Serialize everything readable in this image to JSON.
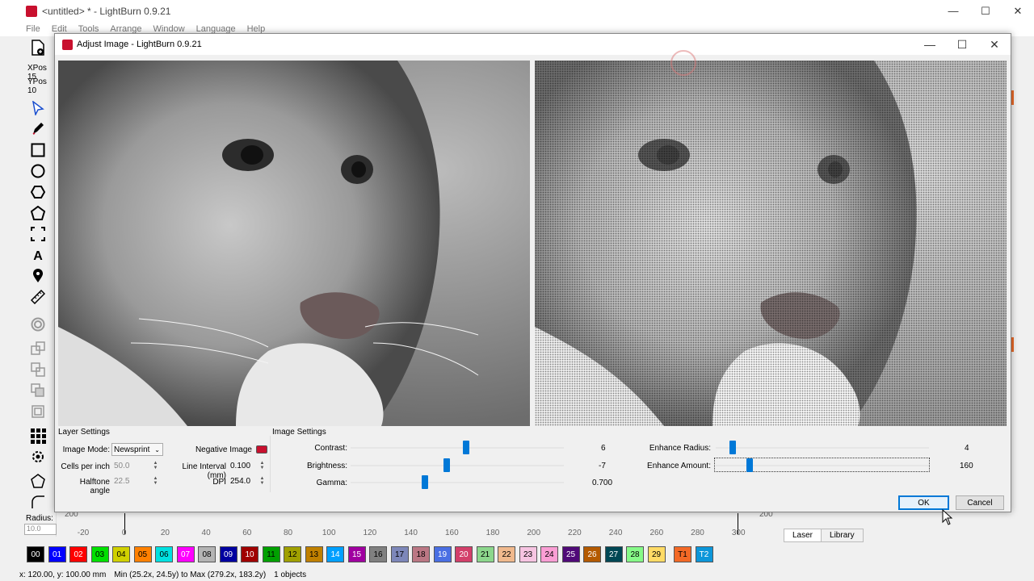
{
  "main_window": {
    "title": "<untitled> * - LightBurn 0.9.21",
    "menu": [
      "File",
      "Edit",
      "Tools",
      "Arrange",
      "Window",
      "Language",
      "Help"
    ],
    "xpos_label": "XPos 15",
    "ypos_label": "YPos 10",
    "radius_label": "Radius:",
    "radius_value": "10.0"
  },
  "dialog": {
    "title": "Adjust Image - LightBurn 0.9.21",
    "layer_settings": {
      "title": "Layer Settings",
      "image_mode_label": "Image Mode:",
      "image_mode_value": "Newsprint",
      "negative_image_label": "Negative Image",
      "cells_per_inch_label": "Cells per inch",
      "cells_per_inch_value": "50.0",
      "line_interval_label": "Line Interval (mm)",
      "line_interval_value": "0.100",
      "halftone_angle_label": "Halftone angle",
      "halftone_angle_value": "22.5",
      "dpi_label": "DPI",
      "dpi_value": "254.0"
    },
    "image_settings": {
      "title": "Image Settings",
      "contrast_label": "Contrast:",
      "contrast_value": "6",
      "brightness_label": "Brightness:",
      "brightness_value": "-7",
      "gamma_label": "Gamma:",
      "gamma_value": "0.700",
      "enhance_radius_label": "Enhance Radius:",
      "enhance_radius_value": "4",
      "enhance_amount_label": "Enhance Amount:",
      "enhance_amount_value": "160"
    },
    "ok_label": "OK",
    "cancel_label": "Cancel"
  },
  "ruler_ticks": [
    "-20",
    "0",
    "20",
    "40",
    "60",
    "80",
    "100",
    "120",
    "140",
    "160",
    "180",
    "200",
    "220",
    "240",
    "260",
    "280",
    "300"
  ],
  "ruler_side_labels": [
    "200",
    "200"
  ],
  "right_tabs": [
    "Laser",
    "Library"
  ],
  "palette": [
    {
      "label": "00",
      "color": "#000000",
      "text": "#ffffff"
    },
    {
      "label": "01",
      "color": "#0000ff",
      "text": "#ffffff"
    },
    {
      "label": "02",
      "color": "#ff0000",
      "text": "#ffffff"
    },
    {
      "label": "03",
      "color": "#00e000",
      "text": "#000000"
    },
    {
      "label": "04",
      "color": "#d0d000",
      "text": "#000000"
    },
    {
      "label": "05",
      "color": "#ff8000",
      "text": "#000000"
    },
    {
      "label": "06",
      "color": "#00e0e0",
      "text": "#000000"
    },
    {
      "label": "07",
      "color": "#ff00ff",
      "text": "#ffffff"
    },
    {
      "label": "08",
      "color": "#b4b4b4",
      "text": "#000000"
    },
    {
      "label": "09",
      "color": "#0000a0",
      "text": "#ffffff"
    },
    {
      "label": "10",
      "color": "#a00000",
      "text": "#ffffff"
    },
    {
      "label": "11",
      "color": "#00a000",
      "text": "#000000"
    },
    {
      "label": "12",
      "color": "#a0a000",
      "text": "#000000"
    },
    {
      "label": "13",
      "color": "#c08000",
      "text": "#000000"
    },
    {
      "label": "14",
      "color": "#00a0ff",
      "text": "#ffffff"
    },
    {
      "label": "15",
      "color": "#a000a0",
      "text": "#ffffff"
    },
    {
      "label": "16",
      "color": "#808080",
      "text": "#000000"
    },
    {
      "label": "17",
      "color": "#7d87b9",
      "text": "#000000"
    },
    {
      "label": "18",
      "color": "#bb7784",
      "text": "#000000"
    },
    {
      "label": "19",
      "color": "#4a6fe3",
      "text": "#ffffff"
    },
    {
      "label": "20",
      "color": "#d33f6a",
      "text": "#ffffff"
    },
    {
      "label": "21",
      "color": "#8cd78c",
      "text": "#000000"
    },
    {
      "label": "22",
      "color": "#f0b98d",
      "text": "#000000"
    },
    {
      "label": "23",
      "color": "#f6c4e1",
      "text": "#000000"
    },
    {
      "label": "24",
      "color": "#fa9ed4",
      "text": "#000000"
    },
    {
      "label": "25",
      "color": "#500a78",
      "text": "#ffffff"
    },
    {
      "label": "26",
      "color": "#b45a00",
      "text": "#ffffff"
    },
    {
      "label": "27",
      "color": "#004754",
      "text": "#ffffff"
    },
    {
      "label": "28",
      "color": "#86fa88",
      "text": "#000000"
    },
    {
      "label": "29",
      "color": "#ffdb66",
      "text": "#000000"
    },
    {
      "label": "T1",
      "color": "#f36926",
      "text": "#000000"
    },
    {
      "label": "T2",
      "color": "#0c96d9",
      "text": "#ffffff"
    }
  ],
  "statusbar": {
    "coords": "x: 120.00, y: 100.00 mm",
    "bounds": "Min (25.2x, 24.5y) to Max (279.2x, 183.2y)",
    "objects": "1 objects"
  },
  "sliders": {
    "contrast": 0.54,
    "brightness": 0.45,
    "gamma": 0.35,
    "enhance_radius": 0.08,
    "enhance_amount": 0.16
  },
  "colors": {
    "accent": "#0078d7",
    "brand": "#c8102e"
  }
}
